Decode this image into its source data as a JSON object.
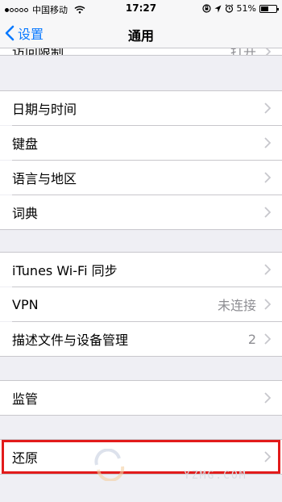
{
  "status_bar": {
    "carrier": "中国移动",
    "time": "17:27",
    "battery": "51%",
    "battery_level": 0.51,
    "signal_bars_filled": 1,
    "icons": [
      "signal-dots-icon",
      "wifi-icon",
      "orientation-lock-icon",
      "location-icon",
      "alarm-icon",
      "battery-icon"
    ]
  },
  "nav": {
    "back_label": "设置",
    "title": "通用"
  },
  "rows": {
    "partial_top": {
      "label": "访问限制",
      "detail": "打开"
    },
    "date_time": "日期与时间",
    "keyboard": "键盘",
    "language_region": "语言与地区",
    "dictionary": "词典",
    "itunes_wifi_sync": "iTunes Wi-Fi 同步",
    "vpn": {
      "label": "VPN",
      "detail": "未连接"
    },
    "profiles": {
      "label": "描述文件与设备管理",
      "detail": "2"
    },
    "supervision": "监管",
    "reset": "还原"
  },
  "highlight_color": "#e21b1b",
  "watermark": {
    "text": "YZMG.COM"
  }
}
